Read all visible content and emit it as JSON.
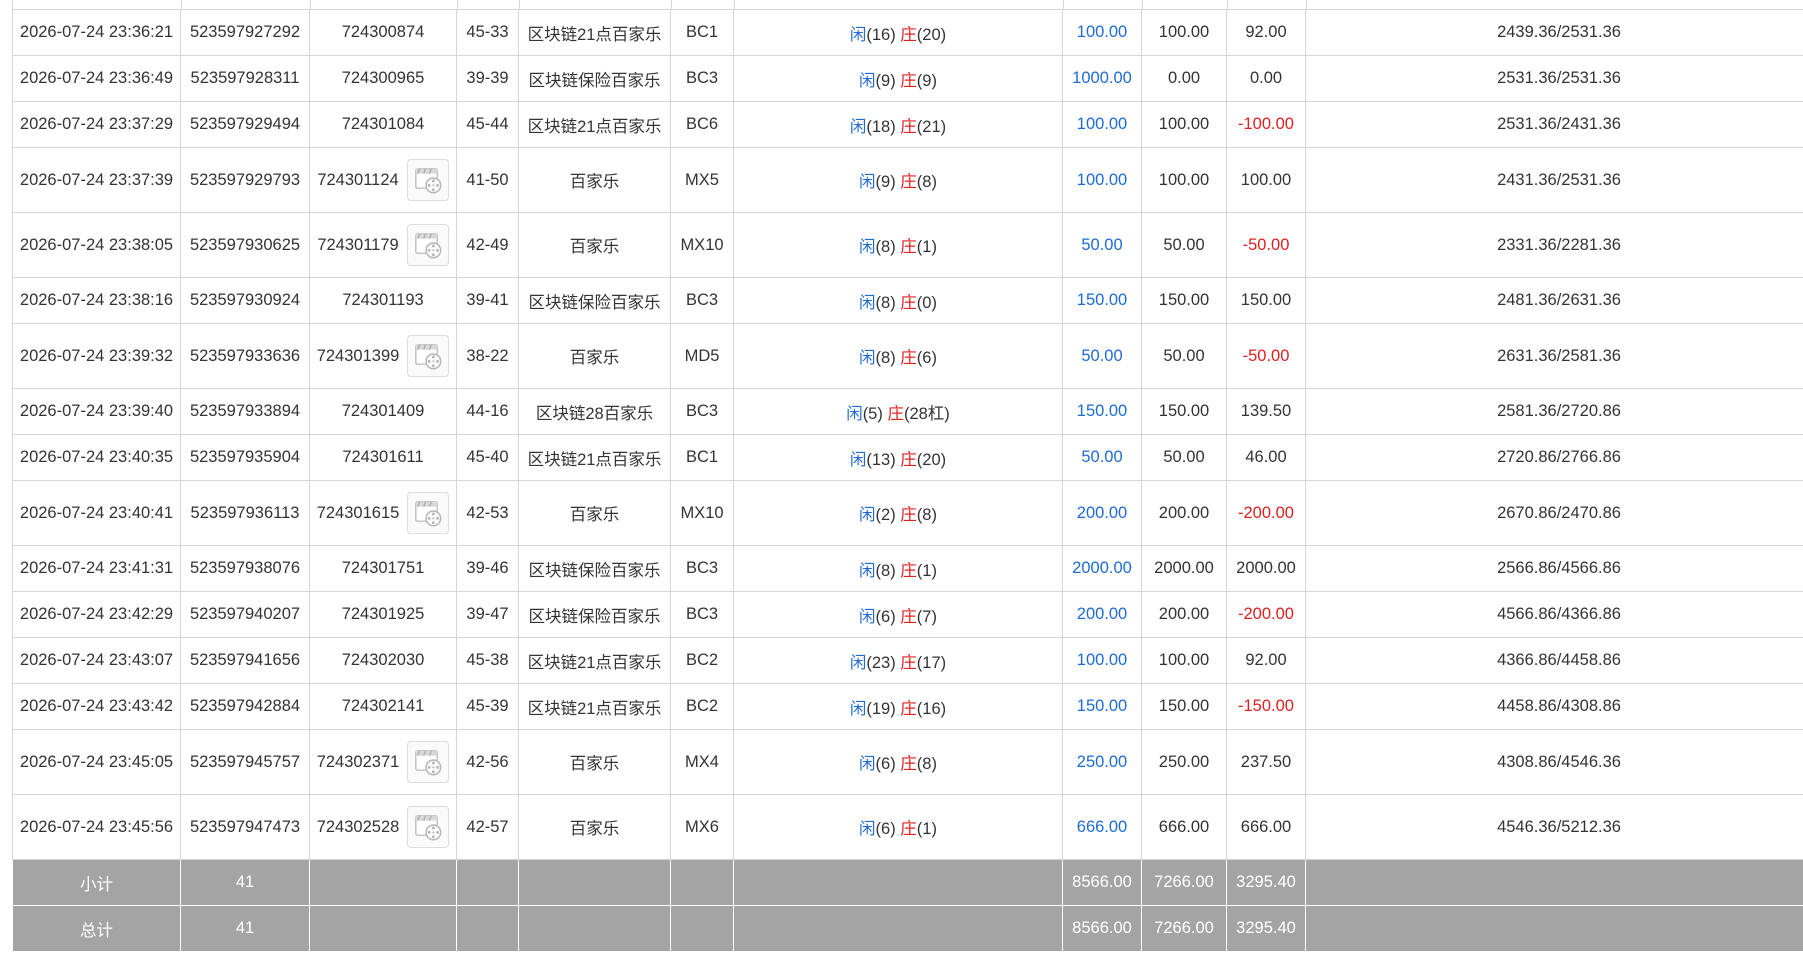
{
  "rows": [
    {
      "time": "2026-07-24 23:36:21",
      "order_no": "523597927292",
      "round": "724300874",
      "video": false,
      "table_no": "45-33",
      "game": "区块链21点百家乐",
      "code": "BC1",
      "player_label": "闲",
      "player_points": "(16)",
      "banker_label": "庄",
      "banker_points": "(20)",
      "bet": "100.00",
      "valid_bet": "100.00",
      "win_loss": "92.00",
      "win_loss_negative": false,
      "balance": "2439.36/2531.36"
    },
    {
      "time": "2026-07-24 23:36:49",
      "order_no": "523597928311",
      "round": "724300965",
      "video": false,
      "table_no": "39-39",
      "game": "区块链保险百家乐",
      "code": "BC3",
      "player_label": "闲",
      "player_points": "(9)",
      "banker_label": "庄",
      "banker_points": "(9)",
      "bet": "1000.00",
      "valid_bet": "0.00",
      "win_loss": "0.00",
      "win_loss_negative": false,
      "balance": "2531.36/2531.36"
    },
    {
      "time": "2026-07-24 23:37:29",
      "order_no": "523597929494",
      "round": "724301084",
      "video": false,
      "table_no": "45-44",
      "game": "区块链21点百家乐",
      "code": "BC6",
      "player_label": "闲",
      "player_points": "(18)",
      "banker_label": "庄",
      "banker_points": "(21)",
      "bet": "100.00",
      "valid_bet": "100.00",
      "win_loss": "-100.00",
      "win_loss_negative": true,
      "balance": "2531.36/2431.36"
    },
    {
      "time": "2026-07-24 23:37:39",
      "order_no": "523597929793",
      "round": "724301124",
      "video": true,
      "table_no": "41-50",
      "game": "百家乐",
      "code": "MX5",
      "player_label": "闲",
      "player_points": "(9)",
      "banker_label": "庄",
      "banker_points": "(8)",
      "bet": "100.00",
      "valid_bet": "100.00",
      "win_loss": "100.00",
      "win_loss_negative": false,
      "balance": "2431.36/2531.36"
    },
    {
      "time": "2026-07-24 23:38:05",
      "order_no": "523597930625",
      "round": "724301179",
      "video": true,
      "table_no": "42-49",
      "game": "百家乐",
      "code": "MX10",
      "player_label": "闲",
      "player_points": "(8)",
      "banker_label": "庄",
      "banker_points": "(1)",
      "bet": "50.00",
      "valid_bet": "50.00",
      "win_loss": "-50.00",
      "win_loss_negative": true,
      "balance": "2331.36/2281.36"
    },
    {
      "time": "2026-07-24 23:38:16",
      "order_no": "523597930924",
      "round": "724301193",
      "video": false,
      "table_no": "39-41",
      "game": "区块链保险百家乐",
      "code": "BC3",
      "player_label": "闲",
      "player_points": "(8)",
      "banker_label": "庄",
      "banker_points": "(0)",
      "bet": "150.00",
      "valid_bet": "150.00",
      "win_loss": "150.00",
      "win_loss_negative": false,
      "balance": "2481.36/2631.36"
    },
    {
      "time": "2026-07-24 23:39:32",
      "order_no": "523597933636",
      "round": "724301399",
      "video": true,
      "table_no": "38-22",
      "game": "百家乐",
      "code": "MD5",
      "player_label": "闲",
      "player_points": "(8)",
      "banker_label": "庄",
      "banker_points": "(6)",
      "bet": "50.00",
      "valid_bet": "50.00",
      "win_loss": "-50.00",
      "win_loss_negative": true,
      "balance": "2631.36/2581.36"
    },
    {
      "time": "2026-07-24 23:39:40",
      "order_no": "523597933894",
      "round": "724301409",
      "video": false,
      "table_no": "44-16",
      "game": "区块链28百家乐",
      "code": "BC3",
      "player_label": "闲",
      "player_points": "(5)",
      "banker_label": "庄",
      "banker_points": "(28杠)",
      "bet": "150.00",
      "valid_bet": "150.00",
      "win_loss": "139.50",
      "win_loss_negative": false,
      "balance": "2581.36/2720.86"
    },
    {
      "time": "2026-07-24 23:40:35",
      "order_no": "523597935904",
      "round": "724301611",
      "video": false,
      "table_no": "45-40",
      "game": "区块链21点百家乐",
      "code": "BC1",
      "player_label": "闲",
      "player_points": "(13)",
      "banker_label": "庄",
      "banker_points": "(20)",
      "bet": "50.00",
      "valid_bet": "50.00",
      "win_loss": "46.00",
      "win_loss_negative": false,
      "balance": "2720.86/2766.86"
    },
    {
      "time": "2026-07-24 23:40:41",
      "order_no": "523597936113",
      "round": "724301615",
      "video": true,
      "table_no": "42-53",
      "game": "百家乐",
      "code": "MX10",
      "player_label": "闲",
      "player_points": "(2)",
      "banker_label": "庄",
      "banker_points": "(8)",
      "bet": "200.00",
      "valid_bet": "200.00",
      "win_loss": "-200.00",
      "win_loss_negative": true,
      "balance": "2670.86/2470.86"
    },
    {
      "time": "2026-07-24 23:41:31",
      "order_no": "523597938076",
      "round": "724301751",
      "video": false,
      "table_no": "39-46",
      "game": "区块链保险百家乐",
      "code": "BC3",
      "player_label": "闲",
      "player_points": "(8)",
      "banker_label": "庄",
      "banker_points": "(1)",
      "bet": "2000.00",
      "valid_bet": "2000.00",
      "win_loss": "2000.00",
      "win_loss_negative": false,
      "balance": "2566.86/4566.86"
    },
    {
      "time": "2026-07-24 23:42:29",
      "order_no": "523597940207",
      "round": "724301925",
      "video": false,
      "table_no": "39-47",
      "game": "区块链保险百家乐",
      "code": "BC3",
      "player_label": "闲",
      "player_points": "(6)",
      "banker_label": "庄",
      "banker_points": "(7)",
      "bet": "200.00",
      "valid_bet": "200.00",
      "win_loss": "-200.00",
      "win_loss_negative": true,
      "balance": "4566.86/4366.86"
    },
    {
      "time": "2026-07-24 23:43:07",
      "order_no": "523597941656",
      "round": "724302030",
      "video": false,
      "table_no": "45-38",
      "game": "区块链21点百家乐",
      "code": "BC2",
      "player_label": "闲",
      "player_points": "(23)",
      "banker_label": "庄",
      "banker_points": "(17)",
      "bet": "100.00",
      "valid_bet": "100.00",
      "win_loss": "92.00",
      "win_loss_negative": false,
      "balance": "4366.86/4458.86"
    },
    {
      "time": "2026-07-24 23:43:42",
      "order_no": "523597942884",
      "round": "724302141",
      "video": false,
      "table_no": "45-39",
      "game": "区块链21点百家乐",
      "code": "BC2",
      "player_label": "闲",
      "player_points": "(19)",
      "banker_label": "庄",
      "banker_points": "(16)",
      "bet": "150.00",
      "valid_bet": "150.00",
      "win_loss": "-150.00",
      "win_loss_negative": true,
      "balance": "4458.86/4308.86"
    },
    {
      "time": "2026-07-24 23:45:05",
      "order_no": "523597945757",
      "round": "724302371",
      "video": true,
      "table_no": "42-56",
      "game": "百家乐",
      "code": "MX4",
      "player_label": "闲",
      "player_points": "(6)",
      "banker_label": "庄",
      "banker_points": "(8)",
      "bet": "250.00",
      "valid_bet": "250.00",
      "win_loss": "237.50",
      "win_loss_negative": false,
      "balance": "4308.86/4546.36"
    },
    {
      "time": "2026-07-24 23:45:56",
      "order_no": "523597947473",
      "round": "724302528",
      "video": true,
      "table_no": "42-57",
      "game": "百家乐",
      "code": "MX6",
      "player_label": "闲",
      "player_points": "(6)",
      "banker_label": "庄",
      "banker_points": "(1)",
      "bet": "666.00",
      "valid_bet": "666.00",
      "win_loss": "666.00",
      "win_loss_negative": false,
      "balance": "4546.36/5212.36"
    }
  ],
  "subtotal": {
    "label": "小计",
    "count": "41",
    "bet": "8566.00",
    "valid_bet": "7266.00",
    "win_loss": "3295.40"
  },
  "total": {
    "label": "总计",
    "count": "41",
    "bet": "8566.00",
    "valid_bet": "7266.00",
    "win_loss": "3295.40"
  },
  "icons": {
    "video": "video-replay-icon"
  },
  "colors": {
    "player": "#1e6bd6",
    "banker": "#e0201f",
    "negative": "#e0201f",
    "summary_bg": "#a4a4a4"
  }
}
